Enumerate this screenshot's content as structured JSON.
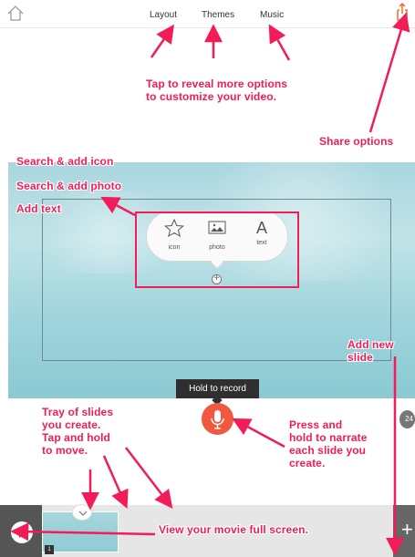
{
  "topbar": {
    "items": [
      {
        "label": "Layout"
      },
      {
        "label": "Themes"
      },
      {
        "label": "Music"
      }
    ]
  },
  "popup": {
    "items": [
      {
        "label": "icon",
        "icon": "star-icon"
      },
      {
        "label": "photo",
        "icon": "image-icon"
      },
      {
        "label": "text",
        "icon": "text-icon",
        "glyph": "A"
      }
    ]
  },
  "recorder": {
    "tooltip": "Hold to record"
  },
  "slide_count": "24",
  "tray": {
    "thumbnail_number": "1"
  },
  "annotations": {
    "top_options": "Tap to reveal more options\nto customize your video.",
    "share_options": "Share options",
    "search_add_icon": "Search & add icon",
    "search_add_photo": "Search & add photo",
    "add_text": "Add text",
    "add_new_slide": "Add new\nslide",
    "tray_slides": "Tray of slides\nyou create.\nTap and hold\nto move.",
    "press_hold": "Press and\nhold to narrate\neach slide you\ncreate.",
    "view_movie": "View your movie full screen."
  },
  "colors": {
    "accent": "#f21d58",
    "record": "#f2573f",
    "dark": "#2f2f2f"
  }
}
